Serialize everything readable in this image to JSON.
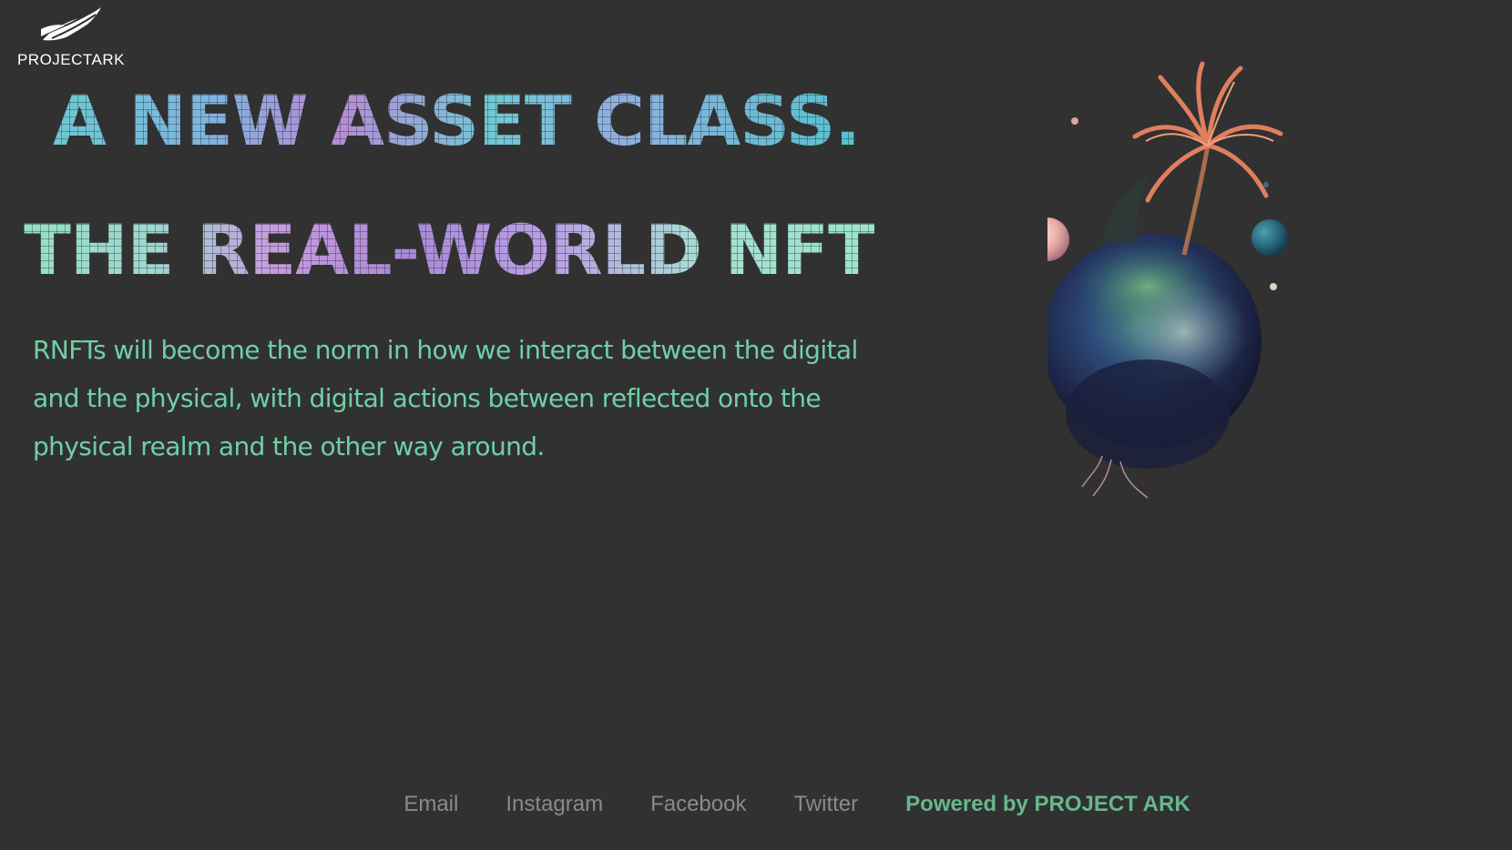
{
  "brand": {
    "logo_name": "wing-logo",
    "name": "PROJECTARK"
  },
  "hero": {
    "headline_1": "A NEW ASSET CLASS.",
    "headline_2": "THE REAL-WORLD NFT",
    "description": "RNFTs will become the norm in how we interact between the digital and the physical, with digital actions between reflected onto the physical realm and the other way around."
  },
  "footer": {
    "links": [
      {
        "label": "Email"
      },
      {
        "label": "Instagram"
      },
      {
        "label": "Facebook"
      },
      {
        "label": "Twitter"
      }
    ],
    "powered_by": "Powered by PROJECT ARK"
  },
  "colors": {
    "background": "#313131",
    "description_text": "#6fd0a6",
    "footer_link": "#8a8a8a",
    "powered_by": "#67b78c"
  }
}
